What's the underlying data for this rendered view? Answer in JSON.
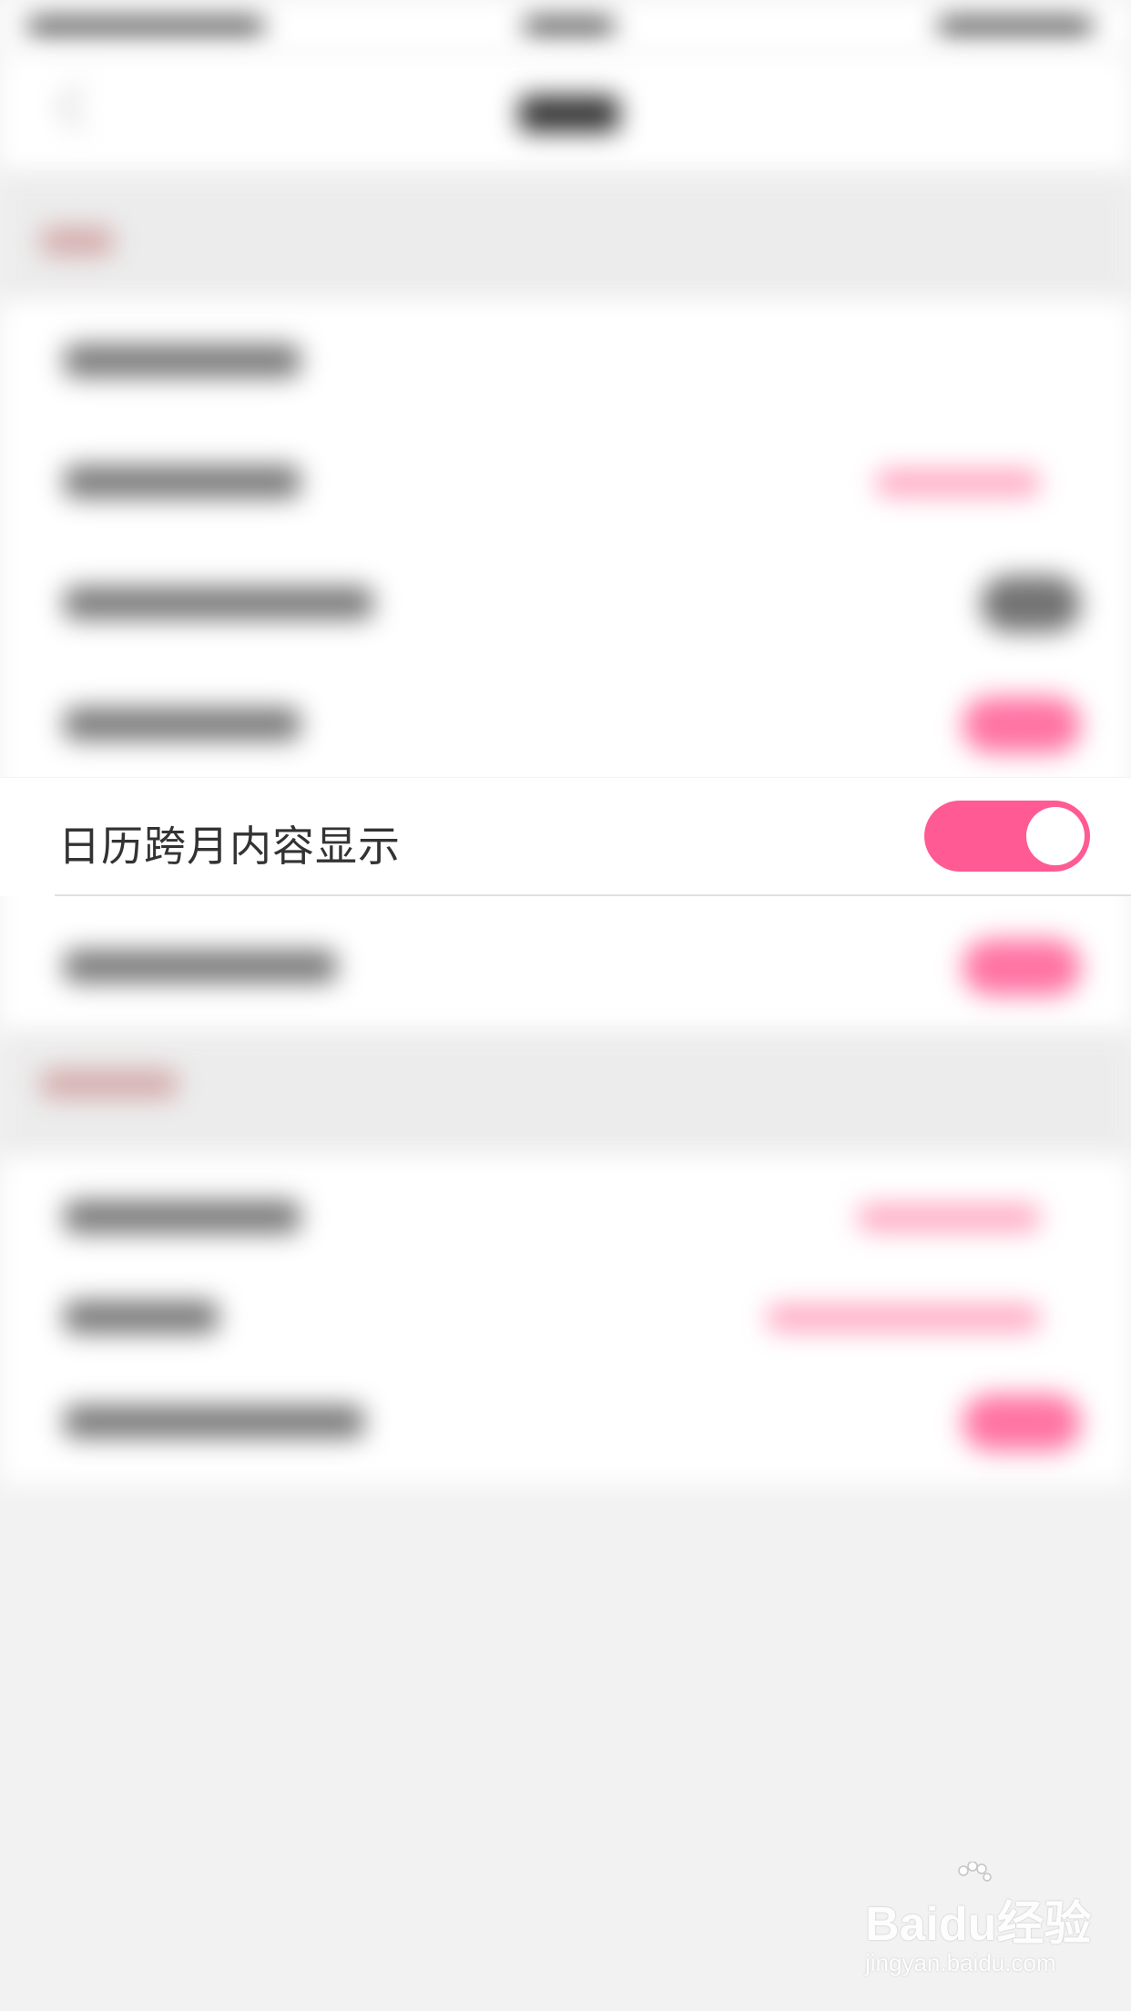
{
  "focus_row": {
    "label": "日历跨月内容显示",
    "toggle_on": true,
    "toggle_color": "#ff5a93"
  },
  "watermark": {
    "main": "Baidu经验",
    "sub": "jingyan.baidu.com"
  },
  "colors": {
    "accent": "#ff5a93",
    "background": "#f2f2f2"
  }
}
